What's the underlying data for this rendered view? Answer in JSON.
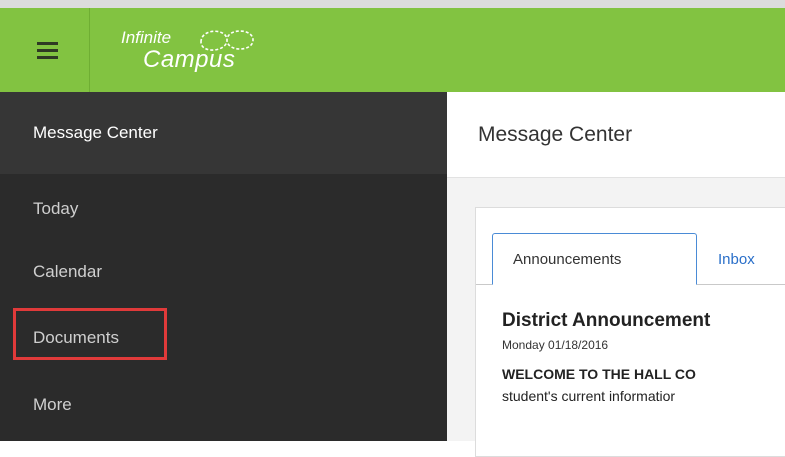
{
  "header": {
    "logo_line1": "Infinite",
    "logo_line2": "Campus",
    "menu_icon": "hamburger-icon",
    "logo_icon": "infinity-loop-icon",
    "accent_color": "#82c341"
  },
  "sidebar": {
    "items": [
      {
        "label": "Message Center",
        "active": true
      },
      {
        "label": "Today"
      },
      {
        "label": "Calendar"
      },
      {
        "label": "Documents",
        "highlighted": true
      },
      {
        "label": "More"
      }
    ],
    "highlight_color": "#e03a3a"
  },
  "main": {
    "title": "Message Center",
    "tabs": [
      {
        "label": "Announcements",
        "active": true
      },
      {
        "label": "Inbox"
      }
    ],
    "announcement": {
      "title": "District Announcement",
      "date": "Monday 01/18/2016",
      "body_line1": "WELCOME TO THE HALL CO",
      "body_line2": "student's current informatior"
    }
  }
}
